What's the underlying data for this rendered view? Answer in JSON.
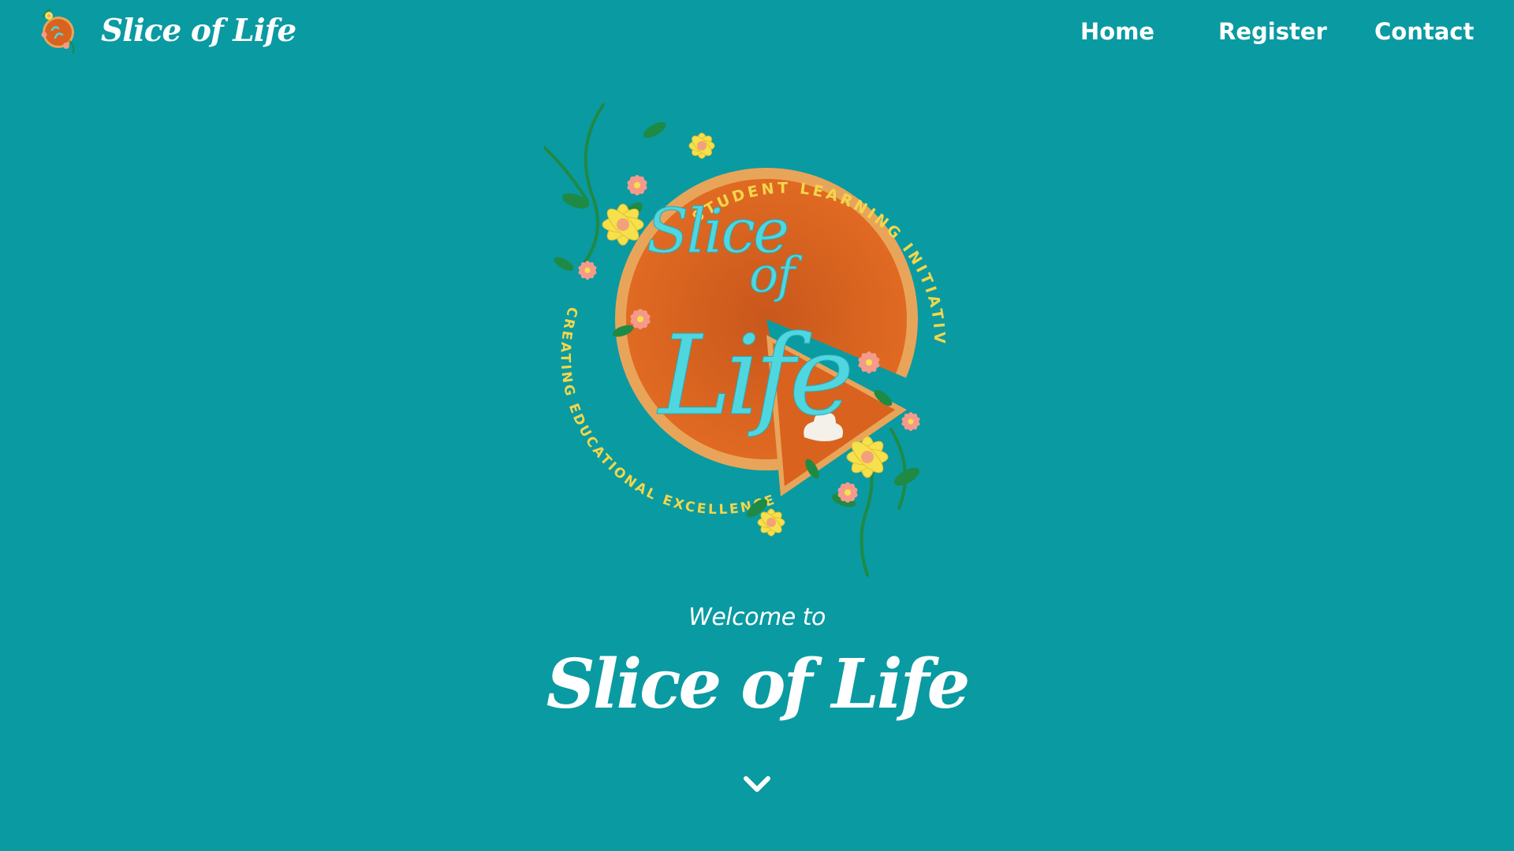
{
  "header": {
    "brand_name": "Slice of Life",
    "brand_logo_icon": "slice-of-life-logo-icon"
  },
  "nav": {
    "items": [
      {
        "label": "Home"
      },
      {
        "label": "Register"
      },
      {
        "label": "Contact"
      }
    ]
  },
  "hero": {
    "emblem": {
      "script_line_1": "Slice",
      "script_line_2": "of",
      "script_line_3": "Life",
      "ring_text_top": "STUDENT LEARNING INITIATIVE",
      "ring_text_bottom": "CREATING EDUCATIONAL EXCELLENCE"
    },
    "welcome_text": "Welcome to",
    "title": "Slice of Life",
    "scroll_icon": "chevron-down-icon"
  },
  "colors": {
    "background": "#0a9aa2",
    "text": "#ffffff",
    "pie_orange": "#d9621f",
    "crust": "#e8a55a",
    "script_cyan": "#4fd6de",
    "ring_text_yellow": "#f3d64a",
    "flower_yellow": "#f6e04c",
    "flower_pink": "#f59a8a",
    "leaf_green": "#1f8a45"
  }
}
